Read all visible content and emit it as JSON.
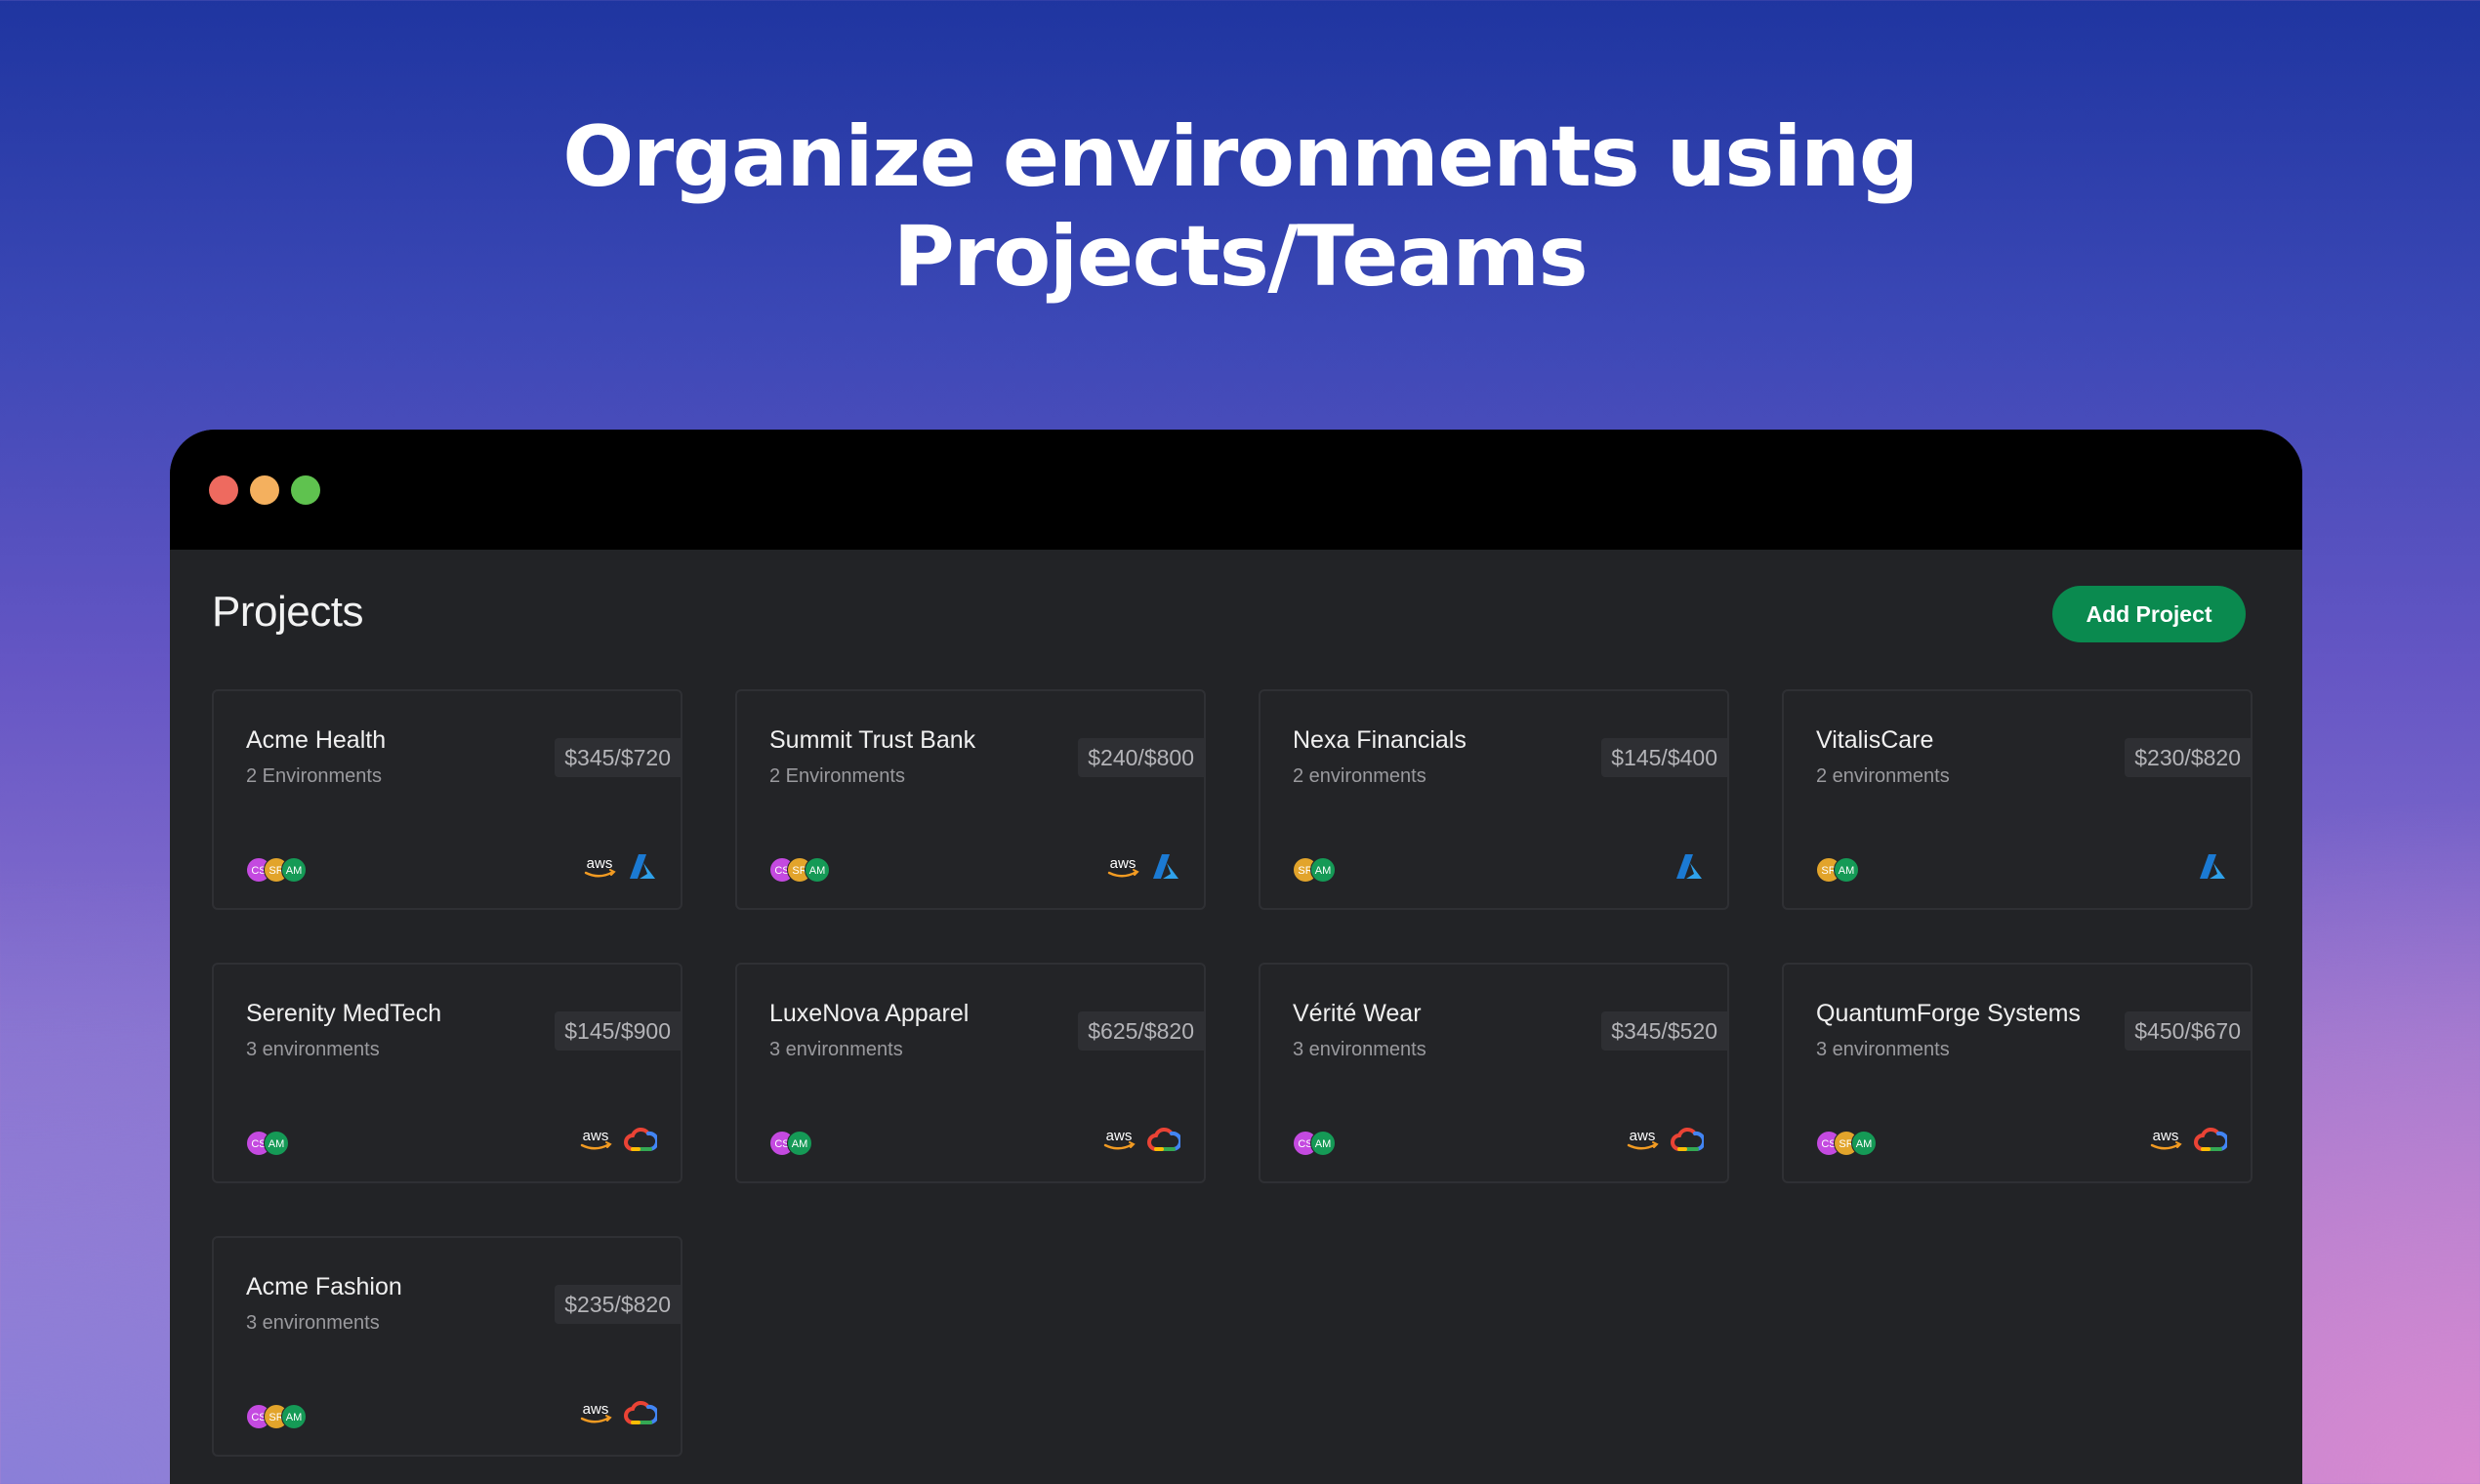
{
  "headline": {
    "line1": "Organize environments using",
    "line2": "Projects/Teams"
  },
  "window": {
    "controls": [
      "close",
      "minimize",
      "maximize"
    ],
    "page_title": "Projects",
    "add_button": "Add Project",
    "accent_color": "#0a8a4f"
  },
  "projects": [
    {
      "name": "Acme Health",
      "environments": "2 Environments",
      "budget": "$345/$720",
      "members": [
        "CS",
        "SR",
        "AM"
      ],
      "providers": [
        "aws",
        "azure"
      ]
    },
    {
      "name": "Summit Trust Bank",
      "environments": "2 Environments",
      "budget": "$240/$800",
      "members": [
        "CS",
        "SR",
        "AM"
      ],
      "providers": [
        "aws",
        "azure"
      ]
    },
    {
      "name": "Nexa Financials",
      "environments": "2 environments",
      "budget": "$145/$400",
      "members": [
        "SR",
        "AM"
      ],
      "providers": [
        "azure"
      ]
    },
    {
      "name": "VitalisCare",
      "environments": "2 environments",
      "budget": "$230/$820",
      "members": [
        "SR",
        "AM"
      ],
      "providers": [
        "azure"
      ]
    },
    {
      "name": "Serenity MedTech",
      "environments": "3 environments",
      "budget": "$145/$900",
      "members": [
        "CS",
        "AM"
      ],
      "providers": [
        "aws",
        "gcp"
      ]
    },
    {
      "name": "LuxeNova Apparel",
      "environments": "3 environments",
      "budget": "$625/$820",
      "members": [
        "CS",
        "AM"
      ],
      "providers": [
        "aws",
        "gcp"
      ]
    },
    {
      "name": "Vérité Wear",
      "environments": "3 environments",
      "budget": "$345/$520",
      "members": [
        "CS",
        "AM"
      ],
      "providers": [
        "aws",
        "gcp"
      ]
    },
    {
      "name": "QuantumForge Systems",
      "environments": "3 environments",
      "budget": "$450/$670",
      "members": [
        "CS",
        "SR",
        "AM"
      ],
      "providers": [
        "aws",
        "gcp"
      ]
    },
    {
      "name": "Acme Fashion",
      "environments": "3 environments",
      "budget": "$235/$820",
      "members": [
        "CS",
        "SR",
        "AM"
      ],
      "providers": [
        "aws",
        "gcp"
      ]
    }
  ],
  "provider_labels": {
    "aws": "aws"
  }
}
